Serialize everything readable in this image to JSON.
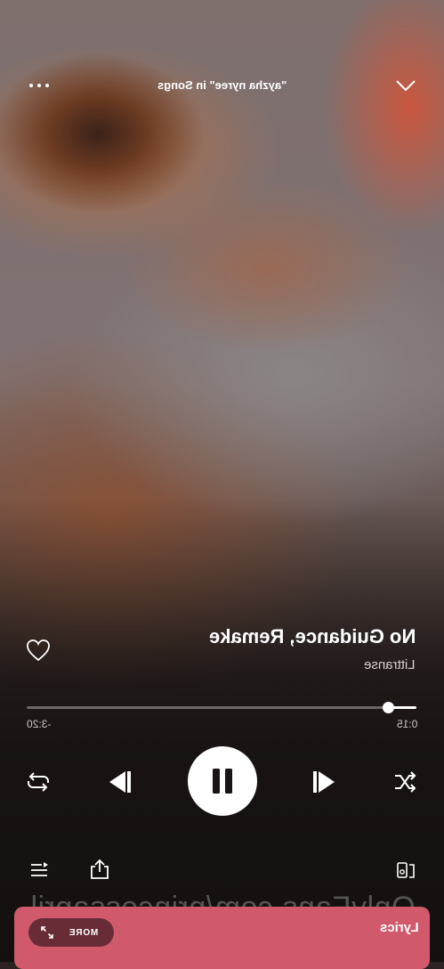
{
  "header": {
    "context_title": "\"ayzha nyree\" in Songs"
  },
  "track": {
    "title": "No Guidance, Remake",
    "artist": "Littranse"
  },
  "progress": {
    "elapsed": "0:15",
    "remaining": "-3:20",
    "fraction": 0.07
  },
  "lyrics": {
    "label": "Lyrics",
    "more_label": "MORE"
  },
  "watermark": "OnlyFans.com/princessapril",
  "icons": [
    "more-options-icon",
    "chevron-down-icon",
    "heart-icon",
    "repeat-icon",
    "previous-icon",
    "pause-icon",
    "next-icon",
    "shuffle-icon",
    "queue-icon",
    "share-icon",
    "connect-device-icon",
    "expand-icon"
  ],
  "colors": {
    "lyrics_bar": "#d05a6c",
    "accent": "#ffffff"
  }
}
